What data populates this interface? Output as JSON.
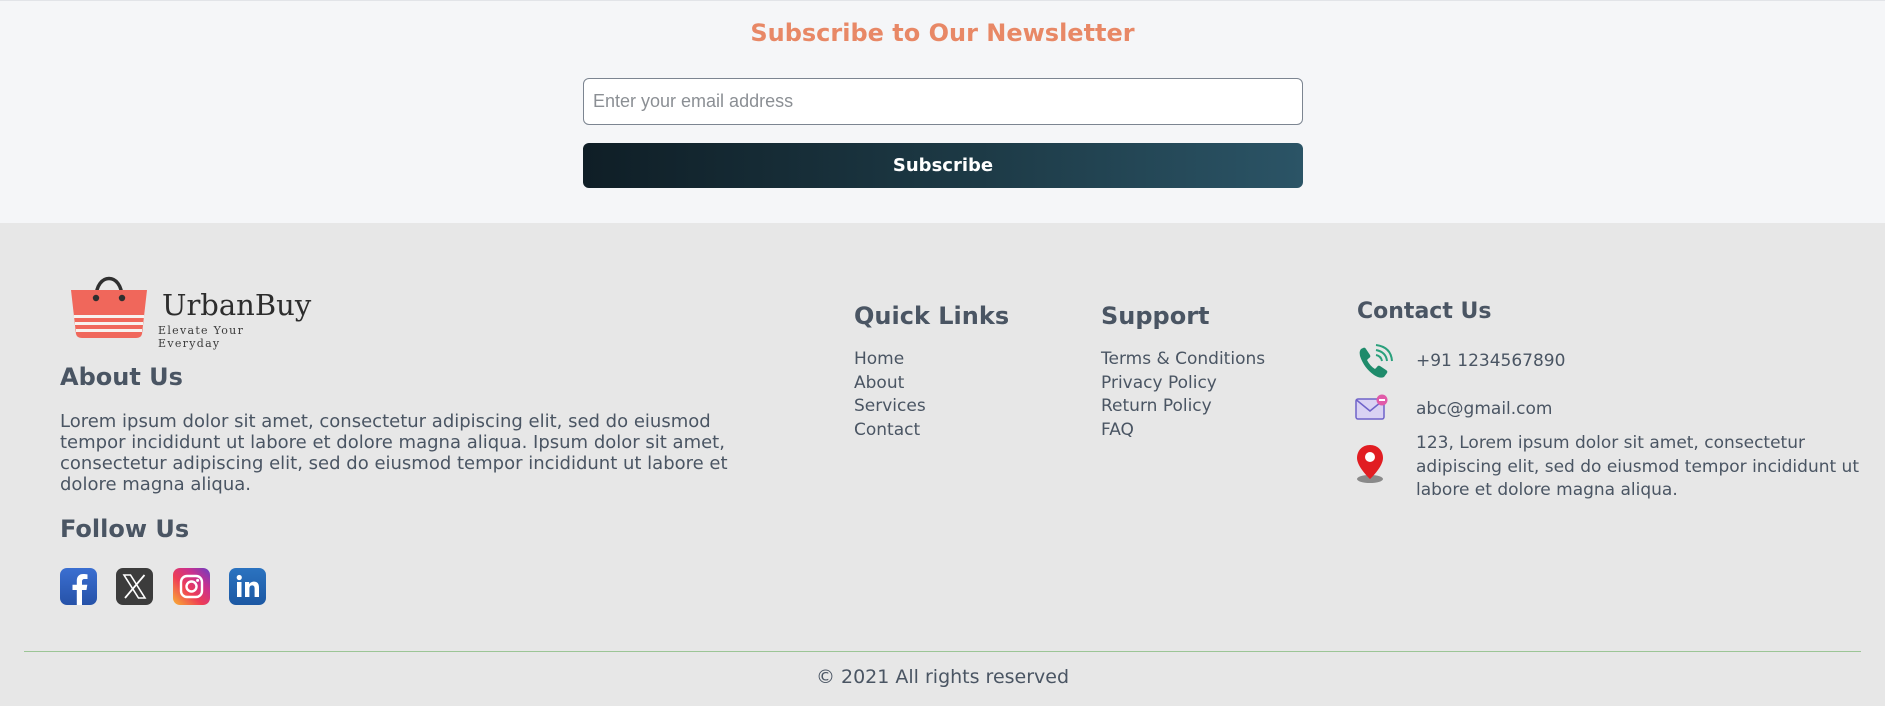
{
  "newsletter": {
    "title": "Subscribe to Our Newsletter",
    "email_placeholder": "Enter your email address",
    "email_value": "",
    "button_label": "Subscribe"
  },
  "brand": {
    "name": "UrbanBuy",
    "tagline": "Elevate Your Everyday",
    "logo_icon": "shopping-bag-icon",
    "accent_color": "#f0675b"
  },
  "about": {
    "heading": "About Us",
    "text": "Lorem ipsum dolor sit amet, consectetur adipiscing elit, sed do eiusmod tempor incididunt ut labore et dolore magna aliqua. Ipsum dolor sit amet, consectetur adipiscing elit, sed do eiusmod tempor incididunt ut labore et dolore magna aliqua."
  },
  "follow": {
    "heading": "Follow Us",
    "icons": [
      "facebook-icon",
      "x-twitter-icon",
      "instagram-icon",
      "linkedin-icon"
    ]
  },
  "quick_links": {
    "heading": "Quick Links",
    "items": [
      "Home",
      "About",
      "Services",
      "Contact"
    ]
  },
  "support": {
    "heading": "Support",
    "items": [
      "Terms & Conditions",
      "Privacy Policy",
      "Return Policy",
      "FAQ"
    ]
  },
  "contact": {
    "heading": "Contact Us",
    "phone": "+91 1234567890",
    "email": "abc@gmail.com",
    "address": "123, Lorem ipsum dolor sit amet, consectetur adipiscing elit, sed do eiusmod tempor incididunt ut labore et dolore magna aliqua.",
    "icons": [
      "phone-icon",
      "mail-icon",
      "location-pin-icon"
    ]
  },
  "footer": {
    "copyright": "© 2021 All rights reserved",
    "divider_color": "#9cc596"
  },
  "colors": {
    "newsletter_bg": "#f5f6f8",
    "footer_bg": "#e7e7e7",
    "title_accent": "#e88866",
    "button_gradient_start": "#0f1e26",
    "button_gradient_end": "#2b5466",
    "text": "#4a5563"
  }
}
